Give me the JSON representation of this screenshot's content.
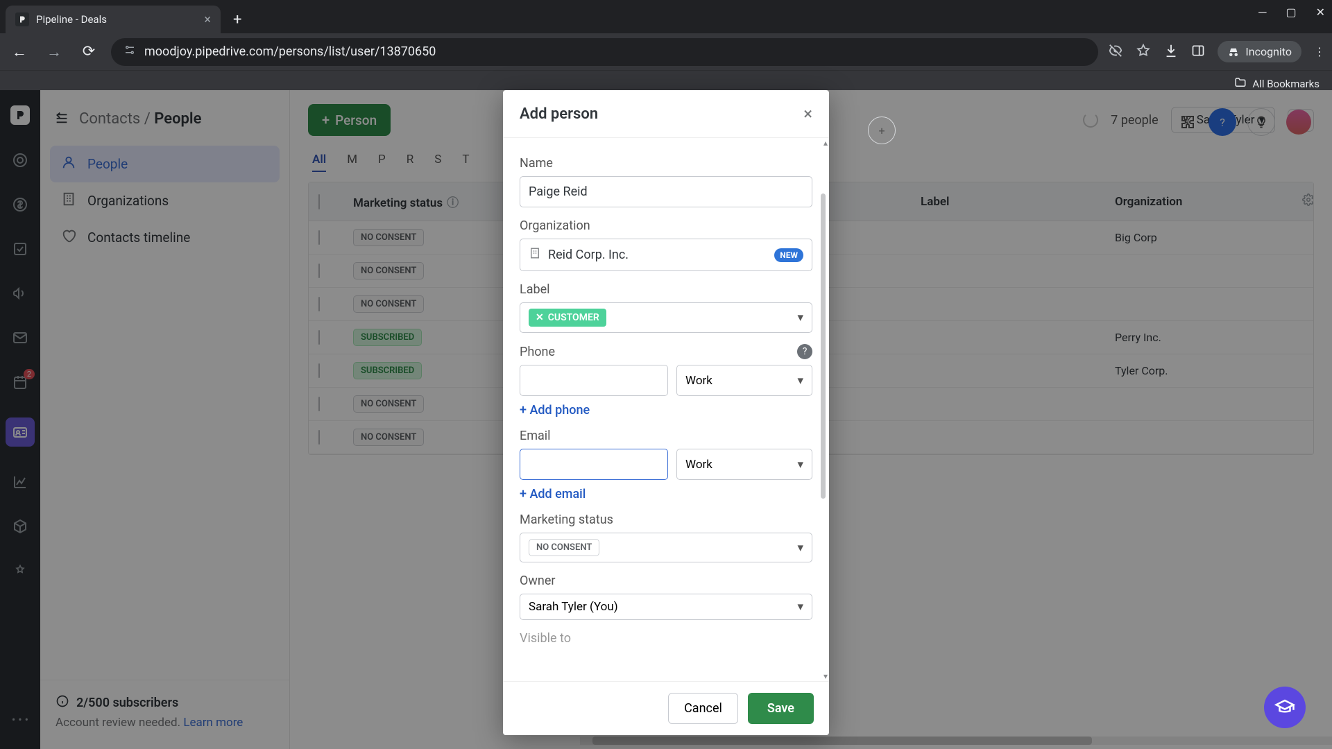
{
  "browser": {
    "tab_title": "Pipeline - Deals",
    "url_display": "moodjoy.pipedrive.com/persons/list/user/13870650",
    "incognito_label": "Incognito",
    "bookmarks_label": "All Bookmarks"
  },
  "header": {
    "breadcrumb_parent": "Contacts",
    "breadcrumb_current": "People"
  },
  "sidebar": {
    "items": [
      {
        "label": "People"
      },
      {
        "label": "Organizations"
      },
      {
        "label": "Contacts timeline"
      }
    ]
  },
  "subscriber_box": {
    "title": "2/500 subscribers",
    "body": "Account review needed.",
    "link": "Learn more"
  },
  "toolbar": {
    "person_btn": "Person",
    "count": "7 people",
    "filter": "Sarah Tyler",
    "alpha": [
      "All",
      "M",
      "P",
      "R",
      "S",
      "T"
    ]
  },
  "table": {
    "columns": [
      "",
      "Marketing status",
      "",
      "Label",
      "Organization",
      ""
    ],
    "rows": [
      {
        "status": "NO CONSENT",
        "status_type": "none",
        "org": "Big Corp"
      },
      {
        "status": "NO CONSENT",
        "status_type": "none",
        "org": ""
      },
      {
        "status": "NO CONSENT",
        "status_type": "none",
        "org": ""
      },
      {
        "status": "SUBSCRIBED",
        "status_type": "sub",
        "org": "Perry Inc."
      },
      {
        "status": "SUBSCRIBED",
        "status_type": "sub",
        "org": "Tyler Corp."
      },
      {
        "status": "NO CONSENT",
        "status_type": "none",
        "org": ""
      },
      {
        "status": "NO CONSENT",
        "status_type": "none",
        "org": ""
      }
    ]
  },
  "modal": {
    "title": "Add person",
    "name_label": "Name",
    "name_value": "Paige Reid",
    "org_label": "Organization",
    "org_value": "Reid Corp. Inc.",
    "org_new": "NEW",
    "label_label": "Label",
    "label_chip": "CUSTOMER",
    "phone_label": "Phone",
    "phone_value": "",
    "phone_kind": "Work",
    "add_phone": "+ Add phone",
    "email_label": "Email",
    "email_value": "",
    "email_kind": "Work",
    "add_email": "+ Add email",
    "mkt_label": "Marketing status",
    "mkt_value": "NO CONSENT",
    "owner_label": "Owner",
    "owner_value": "Sarah Tyler (You)",
    "visible_label": "Visible to",
    "cancel": "Cancel",
    "save": "Save"
  }
}
